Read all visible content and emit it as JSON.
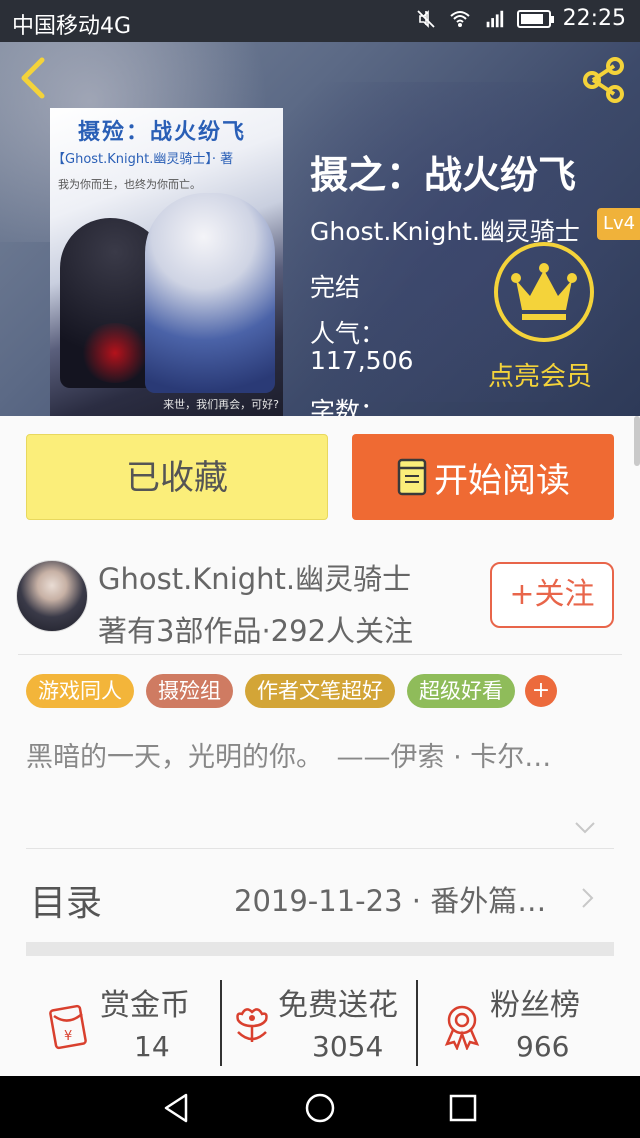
{
  "status_bar": {
    "carrier": "中国移动4G",
    "time": "22:25",
    "icons": [
      "mute-icon",
      "wifi-icon",
      "4g-signal-icon",
      "battery-icon"
    ]
  },
  "header": {
    "icons": {
      "back": "chevron-left-icon",
      "share": "share-icon"
    },
    "cover": {
      "title": "摄殓：战火纷飞",
      "subtitle": "【Ghost.Knight.幽灵骑士】· 著",
      "tagline": "我为你而生，也终为你而亡。",
      "footer": "来世，我们再会，可好?"
    },
    "book_title": "摄之：战火纷飞",
    "author": "Ghost.Knight.幽灵骑士",
    "level_badge": "Lv4",
    "status": "完结",
    "popularity_label": "人气：",
    "popularity_value": "117,506",
    "word_count_label": "字数：",
    "vip_label": "点亮会员",
    "vip_icon": "crown-icon",
    "vip_color": "#f4d33a"
  },
  "actions": {
    "collect_label": "已收藏",
    "read_label": "开始阅读",
    "read_icon": "book-icon",
    "collect_color": "#fbee7a",
    "read_color": "#ef6a33"
  },
  "author_row": {
    "name": "Ghost.Knight.幽灵骑士",
    "meta": "著有3部作品·292人关注",
    "follow_label": "+关注"
  },
  "tags": [
    {
      "label": "游戏同人",
      "color": "#f3b53a"
    },
    {
      "label": "摄殓组",
      "color": "#cf7b62"
    },
    {
      "label": "作者文笔超好",
      "color": "#d3a537"
    },
    {
      "label": "超级好看",
      "color": "#8fbc5a"
    }
  ],
  "tag_add_label": "+",
  "description": "黑暗的一天，光明的你。　——伊索 · 卡尔…",
  "toc": {
    "label": "目录",
    "latest": "2019-11-23 · 番外篇…"
  },
  "stats": [
    {
      "label": "赏金币",
      "value": "14",
      "icon": "red-envelope-icon"
    },
    {
      "label": "免费送花",
      "value": "3054",
      "icon": "flower-icon"
    },
    {
      "label": "粉丝榜",
      "value": "966",
      "icon": "medal-icon"
    }
  ],
  "nav_bar": {
    "icons": [
      "back-triangle-icon",
      "home-circle-icon",
      "recents-square-icon"
    ]
  }
}
